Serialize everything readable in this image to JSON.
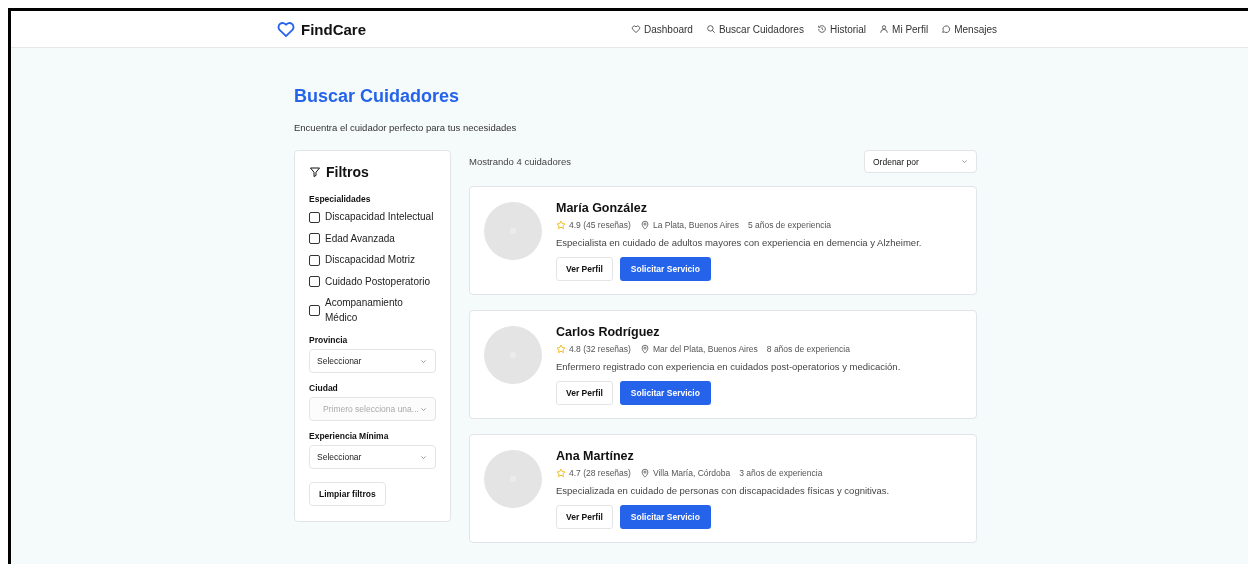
{
  "header": {
    "brand": "FindCare",
    "nav": [
      {
        "label": "Dashboard",
        "kind": "heart"
      },
      {
        "label": "Buscar Cuidadores",
        "kind": "search"
      },
      {
        "label": "Historial",
        "kind": "history"
      },
      {
        "label": "Mi Perfil",
        "kind": "user"
      },
      {
        "label": "Mensajes",
        "kind": "chat"
      }
    ]
  },
  "page": {
    "title": "Buscar Cuidadores",
    "subtitle": "Encuentra el cuidador perfecto para tus necesidades"
  },
  "filters": {
    "title": "Filtros",
    "specialties_label": "Especialidades",
    "specialties": [
      {
        "label": "Discapacidad Intelectual",
        "checked": false
      },
      {
        "label": "Edad Avanzada",
        "checked": false
      },
      {
        "label": "Discapacidad Motriz",
        "checked": false
      },
      {
        "label": "Cuidado Postoperatorio",
        "checked": false
      },
      {
        "label": "Acompanamiento Médico",
        "checked": false
      }
    ],
    "selects": [
      {
        "label": "Provincia",
        "value": "Seleccionar",
        "disabled": false
      },
      {
        "label": "Ciudad",
        "placeholder": "Primero selecciona una...",
        "disabled": true
      },
      {
        "label": "Experiencia Mínima",
        "value": "Seleccionar",
        "disabled": false
      }
    ],
    "clear_button": "Limpiar filtros"
  },
  "results": {
    "count": "Mostrando 4 cuidadores",
    "sort": "Ordenar por",
    "caregivers": [
      {
        "name": "María González",
        "rating": "4.9 (45 reseñas)",
        "location": "La Plata, Buenos Aires",
        "experience": "5 años de experiencia",
        "description": "Especialista en cuidado de adultos mayores con experiencia en demencia y Alzheimer.",
        "profile_button": "Ver Perfil",
        "request_button": "Solicitar Servicio"
      },
      {
        "name": "Carlos Rodríguez",
        "rating": "4.8 (32 reseñas)",
        "location": "Mar del Plata, Buenos Aires",
        "experience": "8 años de experiencia",
        "description": "Enfermero registrado con experiencia en cuidados post-operatorios y medicación.",
        "profile_button": "Ver Perfil",
        "request_button": "Solicitar Servicio"
      },
      {
        "name": "Ana Martínez",
        "rating": "4.7 (28 reseñas)",
        "location": "Villa María, Córdoba",
        "experience": "3 años de experiencia",
        "description": "Especializada en cuidado de personas con discapacidades físicas y cognitivas.",
        "profile_button": "Ver Perfil",
        "request_button": "Solicitar Servicio"
      }
    ]
  }
}
